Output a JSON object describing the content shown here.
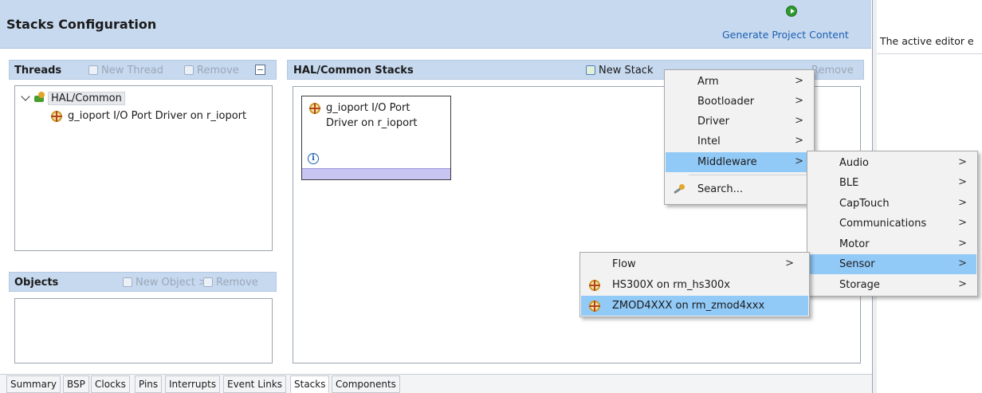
{
  "header": {
    "title": "Stacks Configuration",
    "generate_label": "Generate Project Content"
  },
  "threads": {
    "title": "Threads",
    "new_thread": "New Thread",
    "remove": "Remove",
    "tree": {
      "root": "HAL/Common",
      "child": "g_ioport I/O Port Driver on r_ioport"
    }
  },
  "objects": {
    "title": "Objects",
    "new_object": "New Object >",
    "remove": "Remove"
  },
  "stacks": {
    "title": "HAL/Common Stacks",
    "new_stack": "New Stack",
    "remove": "Remove",
    "block": {
      "line1": "g_ioport I/O Port",
      "line2": "Driver on r_ioport"
    }
  },
  "menu_main": {
    "items": [
      "Arm",
      "Bootloader",
      "Driver",
      "Intel",
      "Middleware"
    ],
    "search": "Search...",
    "highlighted": "Middleware"
  },
  "menu_middleware": {
    "items": [
      "Audio",
      "BLE",
      "CapTouch",
      "Communications",
      "Motor",
      "Sensor",
      "Storage"
    ],
    "highlighted": "Sensor"
  },
  "menu_sensor": {
    "items": [
      "Flow",
      "HS300X on rm_hs300x",
      "ZMOD4XXX on rm_zmod4xxx"
    ],
    "highlighted": "ZMOD4XXX on rm_zmod4xxx"
  },
  "bottom_tabs": [
    "Summary",
    "BSP",
    "Clocks",
    "Pins",
    "Interrupts",
    "Event Links",
    "Stacks",
    "Components"
  ],
  "active_tab": "Stacks",
  "right_pane": {
    "text": "The active editor e"
  },
  "colors": {
    "header_bg": "#c7d9ef",
    "highlight": "#91c9f7",
    "link": "#1b5fb3"
  }
}
